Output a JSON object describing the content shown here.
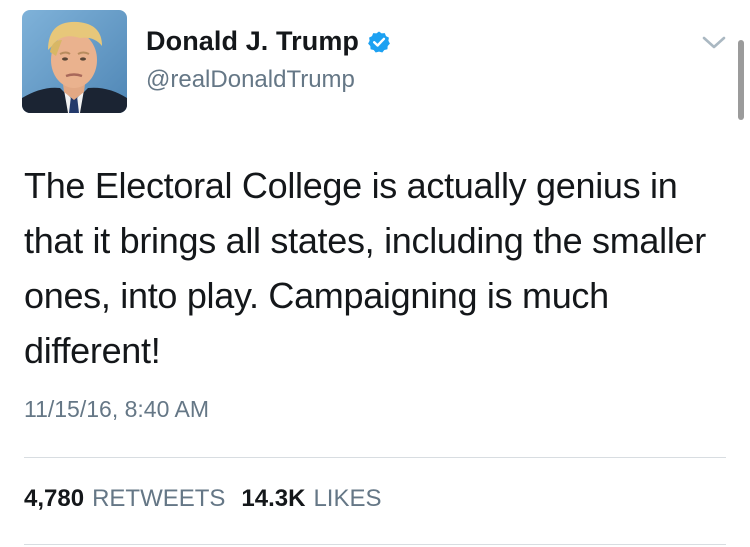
{
  "author": {
    "display_name": "Donald J. Trump",
    "handle": "@realDonaldTrump",
    "verified": true
  },
  "tweet": {
    "text": "The Electoral College is actually genius in that it brings all states, including the smaller ones, into play. Campaigning is much different!",
    "timestamp": "11/15/16, 8:40 AM"
  },
  "stats": {
    "retweets_count": "4,780",
    "retweets_label": "RETWEETS",
    "likes_count": "14.3K",
    "likes_label": "LIKES"
  },
  "icons": {
    "verified": "verified-badge-icon",
    "menu": "chevron-down-icon"
  },
  "colors": {
    "verified_blue": "#1da1f2",
    "secondary_text": "#657786",
    "primary_text": "#14171a",
    "divider": "#d8dde1"
  }
}
